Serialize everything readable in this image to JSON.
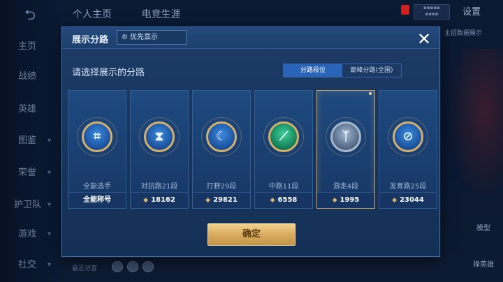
{
  "background": {
    "back_icon": "back-arrow-icon",
    "tabs": [
      "个人主页",
      "电竞生涯"
    ],
    "settings_label": "设置",
    "right_strip_text": "主招数据展示",
    "nav": [
      {
        "label": "主页"
      },
      {
        "label": "战绩"
      },
      {
        "label": "英雄"
      },
      {
        "label": "图鉴"
      },
      {
        "label": "荣誉"
      },
      {
        "label": "护卫队"
      },
      {
        "label": "游戏"
      },
      {
        "label": "社交"
      }
    ],
    "model_label": "模型",
    "hero_label": "择英雄",
    "bottom_text": "最近访客"
  },
  "dialog": {
    "title": "展示分路",
    "priority_label": "优先显示",
    "close_icon": "close-icon",
    "prompt": "请选择展示的分路",
    "segments": [
      {
        "label": "分路段位",
        "active": true
      },
      {
        "label": "巅峰分路(全国)",
        "active": false
      }
    ],
    "cards": [
      {
        "label": "全能选手",
        "value": "全能称号",
        "emblem": "all-round-emblem-icon",
        "show_chevron": false,
        "selected": false
      },
      {
        "label": "对抗路21段",
        "value": "18162",
        "emblem": "clash-lane-emblem-icon",
        "show_chevron": true,
        "selected": false
      },
      {
        "label": "打野29段",
        "value": "29821",
        "emblem": "jungle-emblem-icon",
        "show_chevron": true,
        "selected": false
      },
      {
        "label": "中路11段",
        "value": "6558",
        "emblem": "mid-lane-emblem-icon",
        "show_chevron": true,
        "selected": false
      },
      {
        "label": "游走4段",
        "value": "1995",
        "emblem": "roam-emblem-icon",
        "show_chevron": true,
        "selected": true
      },
      {
        "label": "发育路25段",
        "value": "23044",
        "emblem": "farm-lane-emblem-icon",
        "show_chevron": true,
        "selected": false
      }
    ],
    "confirm_label": "确定"
  },
  "colors": {
    "accent_gold": "#d8ac5f",
    "panel_blue": "#17345c",
    "segment_active": "#2a64b8"
  }
}
